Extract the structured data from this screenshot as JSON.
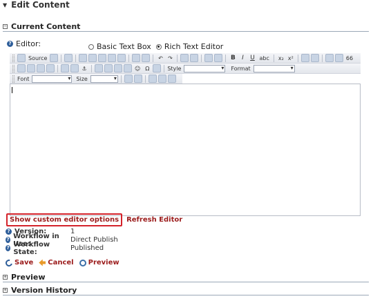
{
  "header": {
    "title": "Edit Content"
  },
  "sections": {
    "current_content": "Current Content",
    "preview": "Preview",
    "version_history": "Version History"
  },
  "editor": {
    "label": "Editor:",
    "options": [
      {
        "label": "Basic Text Box",
        "selected": false
      },
      {
        "label": "Rich Text Editor",
        "selected": true
      }
    ],
    "content": ""
  },
  "toolbar": {
    "source_label": "Source",
    "style_label": "Style",
    "format_label": "Format",
    "font_label": "Font",
    "size_label": "Size",
    "bold": "B",
    "italic": "I",
    "underline": "U",
    "strike": "abc",
    "subscript": "x₂",
    "superscript": "x²",
    "omega": "Ω",
    "quote": "66"
  },
  "links": {
    "show_custom": "Show custom editor options",
    "refresh": "Refresh Editor"
  },
  "meta": [
    {
      "key": "Version:",
      "value": "1"
    },
    {
      "key": "Workflow in Use:",
      "value": "Direct Publish"
    },
    {
      "key": "Workflow State:",
      "value": "Published"
    }
  ],
  "actions": {
    "save": "Save",
    "cancel": "Cancel",
    "preview": "Preview"
  },
  "colors": {
    "link": "#9b1b1b",
    "highlight_border": "#d4222a",
    "icon_blue": "#2e5e9a"
  }
}
